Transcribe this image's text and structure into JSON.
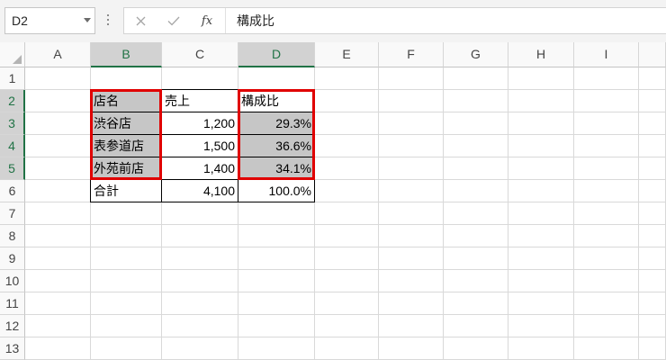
{
  "formula_bar": {
    "name_box": "D2",
    "function_label": "fx",
    "formula": "構成比"
  },
  "icons": {
    "name_box_dropdown": "chevron-down-icon",
    "splitter": "vertical-dots-icon",
    "cancel": "close-icon",
    "enter": "check-icon",
    "select_all": "select-all-triangle-icon"
  },
  "colors": {
    "accent": "#217346",
    "selection": "#c6c6c6",
    "header_selected": "#d2d2d2",
    "gridline": "#d9d9d9",
    "table_border": "#000000",
    "annotation": "#e00000"
  },
  "columns": [
    "A",
    "B",
    "C",
    "D",
    "E",
    "F",
    "G",
    "H",
    "I"
  ],
  "rows": [
    "1",
    "2",
    "3",
    "4",
    "5",
    "6",
    "7",
    "8",
    "9",
    "10",
    "11",
    "12",
    "13"
  ],
  "cells": {
    "B2": {
      "text": "店名",
      "selected": true,
      "annotated": true
    },
    "C2": {
      "text": "売上"
    },
    "D2": {
      "text": "構成比",
      "selected": true,
      "annotated": true
    },
    "B3": {
      "text": "渋谷店",
      "selected": true,
      "annotated": true
    },
    "C3": {
      "text": "1,200"
    },
    "D3": {
      "text": "29.3%",
      "selected": true,
      "annotated": true
    },
    "B4": {
      "text": "表参道店",
      "selected": true,
      "annotated": true
    },
    "C4": {
      "text": "1,500"
    },
    "D4": {
      "text": "36.6%",
      "selected": true,
      "annotated": true
    },
    "B5": {
      "text": "外苑前店",
      "selected": true,
      "annotated": true
    },
    "C5": {
      "text": "1,400"
    },
    "D5": {
      "text": "34.1%",
      "selected": true,
      "annotated": true
    },
    "B6": {
      "text": "合計"
    },
    "C6": {
      "text": "4,100"
    },
    "D6": {
      "text": "100.0%"
    }
  }
}
